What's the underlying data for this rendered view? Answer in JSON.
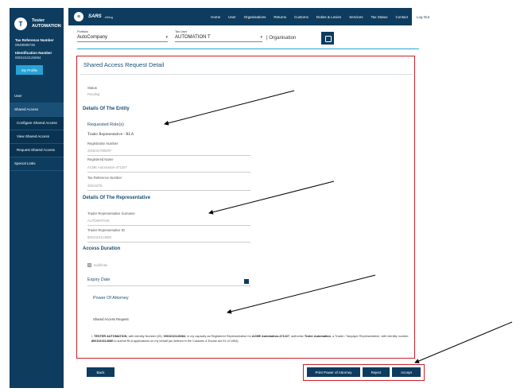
{
  "sidebar": {
    "avatar_letter": "T",
    "user_first": "Tester",
    "user_last": "AUTOMATION",
    "tax_ref_label": "Tax Reference Number",
    "tax_ref_value": "0949599736",
    "id_label": "Identification Number",
    "id_value": "0001010126084",
    "profile_button": "My Profile",
    "items": [
      {
        "label": "User"
      },
      {
        "label": "Shared Access"
      },
      {
        "label": "Configure Shared Access"
      },
      {
        "label": "View Shared Access"
      },
      {
        "label": "Request Shared Access"
      },
      {
        "label": "Special Links"
      }
    ]
  },
  "topnav": {
    "logo": "SARS",
    "logo_sub": "efiling",
    "items": [
      "Home",
      "User",
      "Organisations",
      "Returns",
      "Customs",
      "Duties & Levies",
      "Services",
      "Tax Status",
      "Contact"
    ],
    "logout": "Log Out"
  },
  "selectors": {
    "portfolio_caption": "Portfolio",
    "portfolio_value": "AutoCompany",
    "taxuser_caption": "Tax User",
    "taxuser_value": "AUTOMATION T",
    "org_label": "Organisation"
  },
  "panel": {
    "title": "Shared Access Request Detail",
    "status_label": "Status",
    "status_value": "Pending",
    "entity_head": "Details Of The Entity",
    "roles_head": "Requested Role(s)",
    "role_value": "Trader Representative - RLA",
    "reg_num_label": "Registration Number",
    "reg_num_value": "2018/417005/07",
    "reg_name_label": "Registered Name",
    "reg_name_value": "ACME Automation-471227",
    "tax_ref_label": "Tax Reference Number",
    "tax_ref_value": "20014275",
    "rep_head": "Details Of The Representative",
    "rep_surname_label": "Trader Representative Surname",
    "rep_surname_value": "AUTOMATION",
    "rep_id_label": "Trader Representative ID",
    "rep_id_value": "8001010114080",
    "duration_head": "Access Duration",
    "indefinite_label": "Indefinite",
    "expiry_label": "Expiry Date",
    "poa_head": "Power Of Attorney",
    "shared_req_label": "Shared Access Request",
    "poa_p1": "I, ",
    "poa_name": "TESTER AUTOMATION",
    "poa_p2": ", with Identity Number (ID): ",
    "poa_id": "0001010126084",
    "poa_p3": ", in my capacity as Registered Representative for ",
    "poa_org": "ACME Automation-471227",
    "poa_p4": ", authorise ",
    "poa_rep": "Tester Automation",
    "poa_p5": ", a Trader / Taxpayer Representative, with Identity number: ",
    "poa_repid": "8001010114080",
    "poa_p6": " to submit RLA applications on my behalf (as defined in the Customs & Excise Act 91 of 1964)."
  },
  "buttons": {
    "back": "Back",
    "print": "Print Power of Attorney",
    "reject": "Reject",
    "accept": "Accept"
  },
  "colors": {
    "navy": "#0d3c5e",
    "annotation_red": "#d01f26",
    "accent_blue": "#27a3d6"
  }
}
